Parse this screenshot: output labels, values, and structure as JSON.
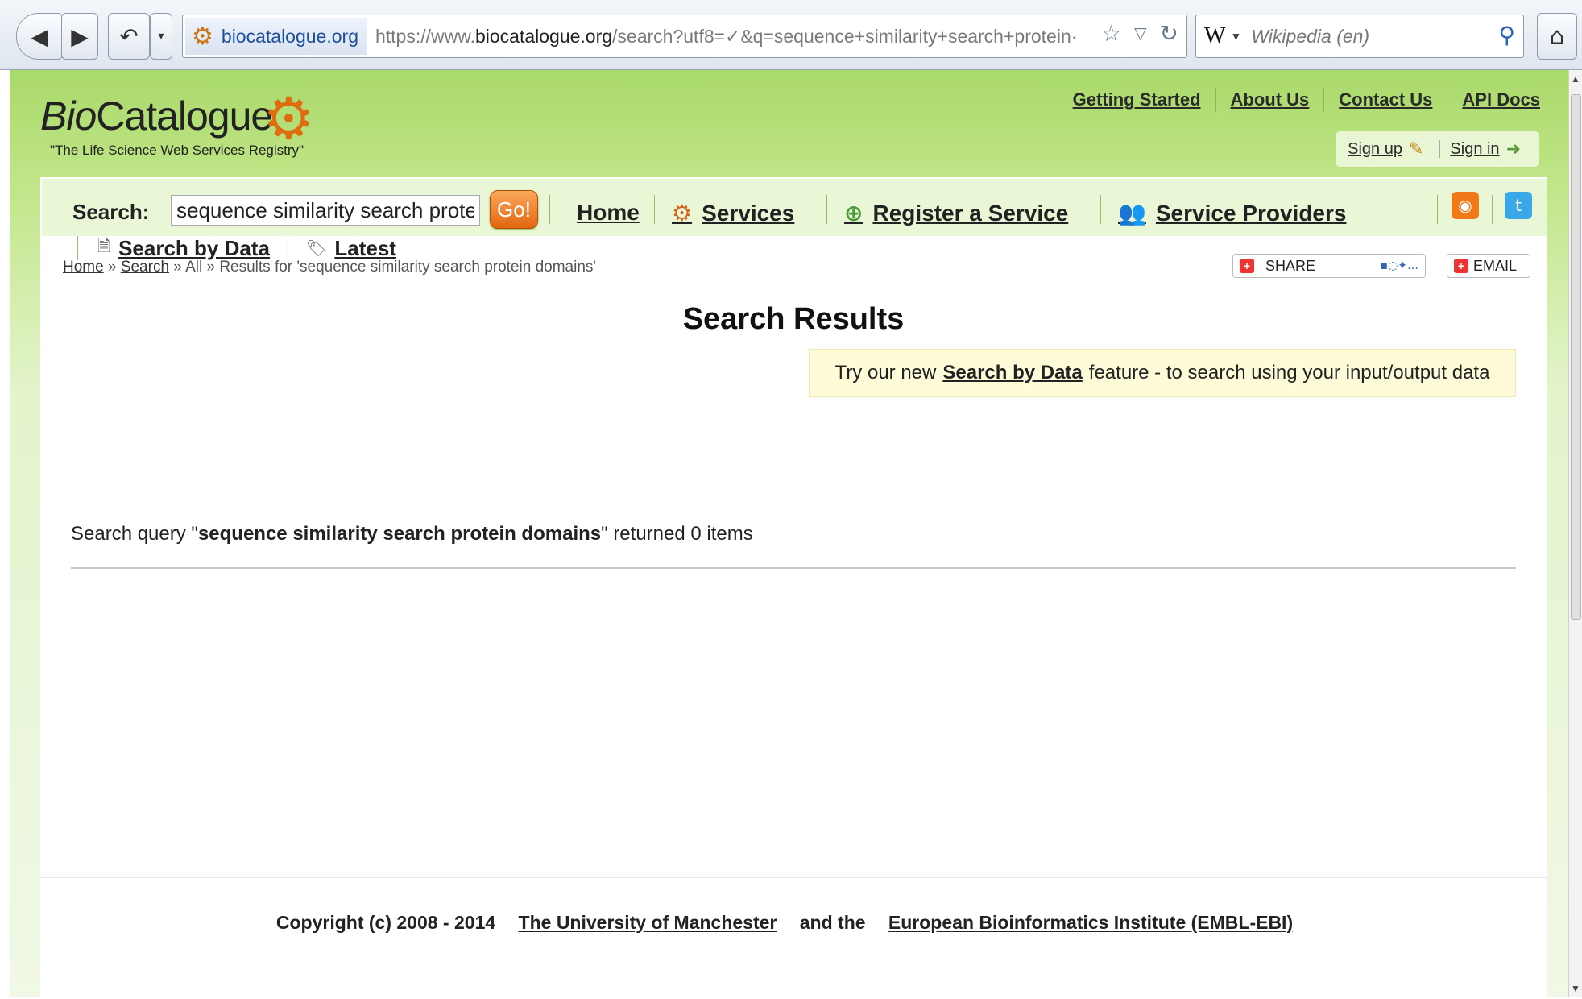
{
  "browser": {
    "site_identity": "biocatalogue.org",
    "url_prefix": "https://www.",
    "url_domain": "biocatalogue.org",
    "url_rest": "/search?utf8=✓&q=sequence+similarity+search+protein·",
    "search_engine_letter": "W",
    "search_placeholder": "Wikipedia (en)"
  },
  "header": {
    "logo_name_italic": "Bio",
    "logo_name_rest": "Catalogue",
    "logo_tagline": "\"The Life Science Web Services Registry\"",
    "top_links": [
      "Getting Started",
      "About Us",
      "Contact Us",
      "API Docs"
    ],
    "sign_up": "Sign up",
    "sign_in": "Sign in"
  },
  "navbar": {
    "search_label": "Search:",
    "search_value": "sequence similarity search protein domains",
    "go_label": "Go!",
    "links": [
      "Home",
      "Services",
      "Register a Service",
      "Service Providers"
    ],
    "sub_links": [
      "Search by Data",
      "Latest"
    ]
  },
  "breadcrumb": {
    "home": "Home",
    "sep1": " » ",
    "search": "Search",
    "rest": " » All » Results for 'sequence similarity search protein domains'"
  },
  "share": {
    "share_label": "SHARE",
    "email_label": "EMAIL"
  },
  "main": {
    "title": "Search Results",
    "promo_pre": "Try our new",
    "promo_link": "Search by Data",
    "promo_post": "feature - to search using your input/output data",
    "result_pre": "Search query \"",
    "result_query": "sequence similarity search protein domains",
    "result_post": "\" returned 0 items"
  },
  "footer": {
    "copyright": "Copyright (c) 2008 - 2014",
    "link1": "The University of Manchester",
    "and_text": "and the",
    "link2": "European Bioinformatics Institute (EMBL-EBI)"
  },
  "colors": {
    "header_green": "#a9d96a",
    "go_orange": "#e2660f",
    "logo_gear": "#e06c10",
    "promo_bg": "#fdfbd8"
  }
}
